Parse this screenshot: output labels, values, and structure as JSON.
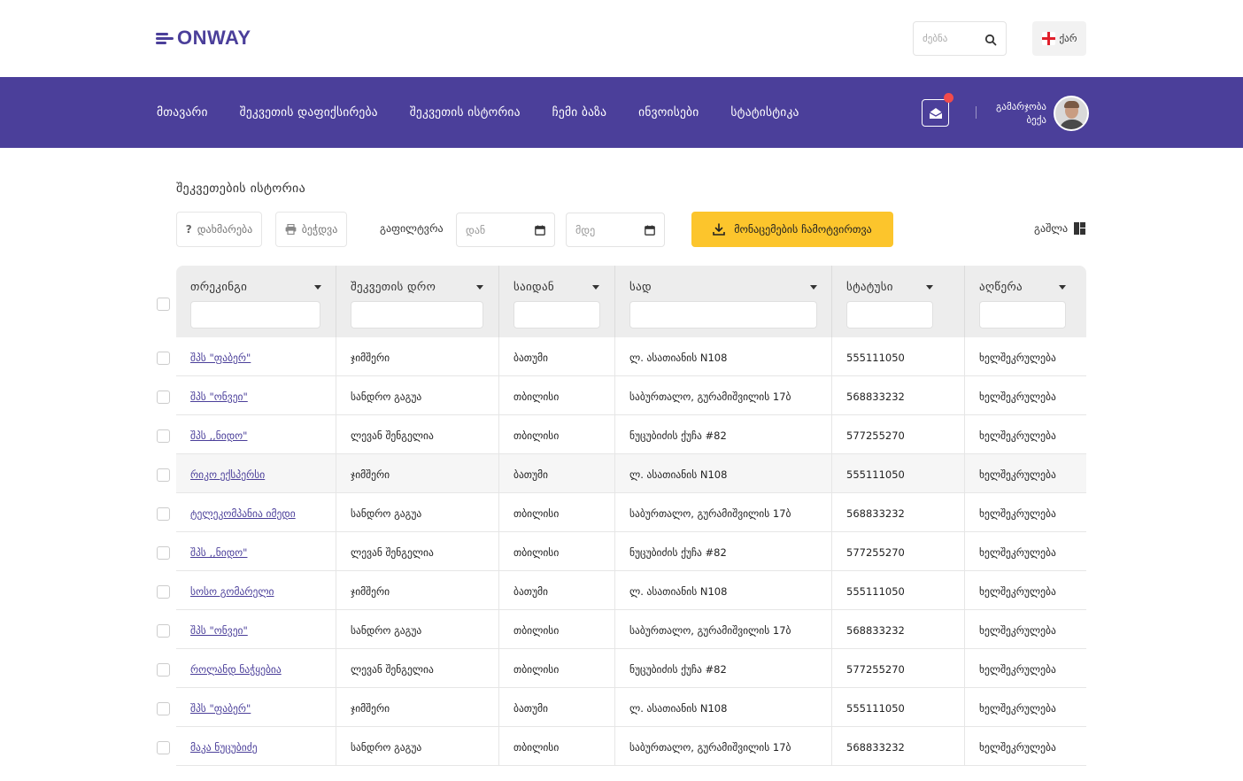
{
  "brand": {
    "logo_text": "ONWAY",
    "color": "#4b3f9a"
  },
  "search": {
    "placeholder": "ძებნა",
    "icon": "search-icon"
  },
  "language": {
    "label": "ქარ",
    "flag": "georgia-flag-icon"
  },
  "nav": {
    "items": [
      "მთავარი",
      "შეკვეთის დაფიქსირება",
      "შეკვეთის ისტორია",
      "ჩემი ბაზა",
      "ინვოისები",
      "სტატისტიკა"
    ],
    "mail_icon": "mail-open-icon",
    "notification_color": "#f24b4b"
  },
  "user": {
    "greeting": "გამარჯობა",
    "name": "ბექა"
  },
  "page": {
    "title": "შეკვეთების ისტორია",
    "help_label": "დახმარება",
    "print_label": "ბეჭდვა",
    "filter_label": "გაფილტვრა",
    "date_from_placeholder": "დან",
    "date_to_placeholder": "მდე",
    "download_label": "მონაცემების ჩამოტვირთვა",
    "layout_label": "გაშლა",
    "accent_color": "#fcc52c"
  },
  "table": {
    "columns": [
      "თრეკინგი",
      "შეკვეთის დრო",
      "საიდან",
      "სად",
      "სტატუსი",
      "აღწერა"
    ],
    "rows": [
      [
        "შპს \"ფაბერ\"",
        "ჯიმშერი",
        "ბათუმი",
        "ლ. ასათიანის N108",
        "555111050",
        "ხელშეკრულება"
      ],
      [
        "შპს \"ონვეი\"",
        "სანდრო გაგუა",
        "თბილისი",
        "საბურთალო, გურამიშვილის 17ბ",
        "568833232",
        "ხელშეკრულება"
      ],
      [
        "შპს ,,ნიდო\"",
        "ლევან შენგელია",
        "თბილისი",
        "ნუცუბიძის ქუჩა #82",
        "577255270",
        "ხელშეკრულება"
      ],
      [
        "რიკო ექსპერსი",
        "ჯიმშერი",
        "ბათუმი",
        "ლ. ასათიანის N108",
        "555111050",
        "ხელშეკრულება"
      ],
      [
        "ტელეკომპანია იმედი",
        "სანდრო გაგუა",
        "თბილისი",
        "საბურთალო, გურამიშვილის 17ბ",
        "568833232",
        "ხელშეკრულება"
      ],
      [
        "შპს ,,ნიდო\"",
        "ლევან შენგელია",
        "თბილისი",
        "ნუცუბიძის ქუჩა #82",
        "577255270",
        "ხელშეკრულება"
      ],
      [
        "სოსო გომარელი",
        "ჯიმშერი",
        "ბათუმი",
        "ლ. ასათიანის N108",
        "555111050",
        "ხელშეკრულება"
      ],
      [
        "შპს \"ონვეი\"",
        "სანდრო გაგუა",
        "თბილისი",
        "საბურთალო, გურამიშვილის 17ბ",
        "568833232",
        "ხელშეკრულება"
      ],
      [
        "როლანდ ნაჭყებია",
        "ლევან შენგელია",
        "თბილისი",
        "ნუცუბიძის ქუჩა #82",
        "577255270",
        "ხელშეკრულება"
      ],
      [
        "შპს \"ფაბერ\"",
        "ჯიმშერი",
        "ბათუმი",
        "ლ. ასათიანის N108",
        "555111050",
        "ხელშეკრულება"
      ],
      [
        "მაკა ნუცუბიძე",
        "სანდრო გაგუა",
        "თბილისი",
        "საბურთალო, გურამიშვილის 17ბ",
        "568833232",
        "ხელშეკრულება"
      ]
    ],
    "highlighted_row": 3
  }
}
